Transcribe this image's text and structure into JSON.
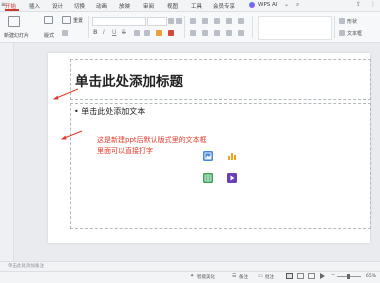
{
  "menubar": {
    "items": [
      "开始",
      "插入",
      "设计",
      "切换",
      "动画",
      "放映",
      "审阅",
      "视图",
      "工具",
      "会员专享"
    ],
    "wps_ai": "WPS AI",
    "active_color": "#c73a2c"
  },
  "ribbon": {
    "new_slide": "新建幻灯片",
    "layout": "版式",
    "reset": "重置",
    "shape": "形状",
    "textbox": "文本框"
  },
  "slide": {
    "title_placeholder": "单击此处添加标题",
    "content_placeholder": "• 单击此处添加文本"
  },
  "annotation": {
    "line1": "这是新建ppt后默认版式里的文本框",
    "line2": "里面可以直接打字",
    "color": "#e03a2c"
  },
  "placeholder_icons": [
    "picture-icon",
    "chart-icon",
    "table-icon",
    "video-icon"
  ],
  "notes": {
    "placeholder": "单击此处添加备注"
  },
  "statusbar": {
    "smart_beautify": "智能美化",
    "notes": "备注",
    "comments": "批注",
    "zoom": "65%"
  }
}
